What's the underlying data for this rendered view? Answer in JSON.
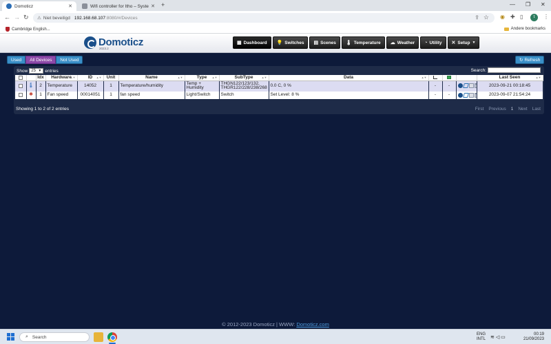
{
  "browser": {
    "tabs": [
      {
        "title": "Domoticz"
      },
      {
        "title": "Wifi controller for Itho – Systen"
      }
    ],
    "omnibox": {
      "security_label": "Niet beveiligd",
      "host": "192.168.68.107",
      "rest": ":8080/#/Devices"
    },
    "profile_initial": "t",
    "bookmarks": {
      "left": "Cambridge English...",
      "right": "Andere bookmarks"
    }
  },
  "app": {
    "logo": {
      "name": "Domoticz",
      "version": "2023.2"
    },
    "nav": [
      {
        "label": "Dashboard",
        "icon": "dashboard-icon",
        "glyph": "▦"
      },
      {
        "label": "Switches",
        "icon": "lightbulb-icon",
        "glyph": "💡"
      },
      {
        "label": "Scenes",
        "icon": "scenes-icon",
        "glyph": "▤"
      },
      {
        "label": "Temperature",
        "icon": "thermometer-icon",
        "glyph": "🌡"
      },
      {
        "label": "Weather",
        "icon": "cloud-icon",
        "glyph": "☁"
      },
      {
        "label": "Utility",
        "icon": "gauge-icon",
        "glyph": "◔"
      },
      {
        "label": "Setup",
        "icon": "tools-icon",
        "glyph": "✕"
      }
    ],
    "filters": {
      "used": "Used",
      "all": "All Devices",
      "not_used": "Not Used"
    },
    "refresh_label": "Refresh",
    "table": {
      "show_label": "Show",
      "page_length": "25",
      "entries_label": "entries",
      "search_label": "Search:",
      "columns": {
        "idx": "Idx",
        "hardware": "Hardware",
        "id": "ID",
        "unit": "Unit",
        "name": "Name",
        "type": "Type",
        "subtype": "SubType",
        "data": "Data",
        "last_seen": "Last Seen"
      },
      "rows": [
        {
          "idx": "2",
          "hardware": "Temperature",
          "id": "14052",
          "unit": "1",
          "name": "Temperature/humidity",
          "type_line1": "Temp +",
          "type_line2": "Humidity",
          "subtype_line1": "THGN122/123/132,",
          "subtype_line2": "THGR122/228/238/268",
          "data": "0.0 C, 0 %",
          "signal": "-",
          "battery": "-",
          "last_seen": "2023-09-21 00:18:45",
          "icon": "thermometer-icon"
        },
        {
          "idx": "1",
          "hardware": "Fan speed",
          "id": "00014051",
          "unit": "1",
          "name": "fan speed",
          "type": "Light/Switch",
          "subtype": "Switch",
          "data": "Set Level: 8 %",
          "signal": "-",
          "battery": "-",
          "last_seen": "2023-09-07 21:54:24",
          "icon": "fan-icon"
        }
      ],
      "info": "Showing 1 to 2 of 2 entries",
      "pager": {
        "first": "First",
        "previous": "Previous",
        "current": "1",
        "next": "Next",
        "last": "Last"
      }
    },
    "footer": {
      "text": "© 2012-2023 Domoticz | WWW:",
      "link": "Domoticz.com"
    }
  },
  "taskbar": {
    "search_placeholder": "Search",
    "lang_line1": "ENG",
    "lang_line2": "INTL",
    "time": "00:19",
    "date": "21/09/2023"
  }
}
